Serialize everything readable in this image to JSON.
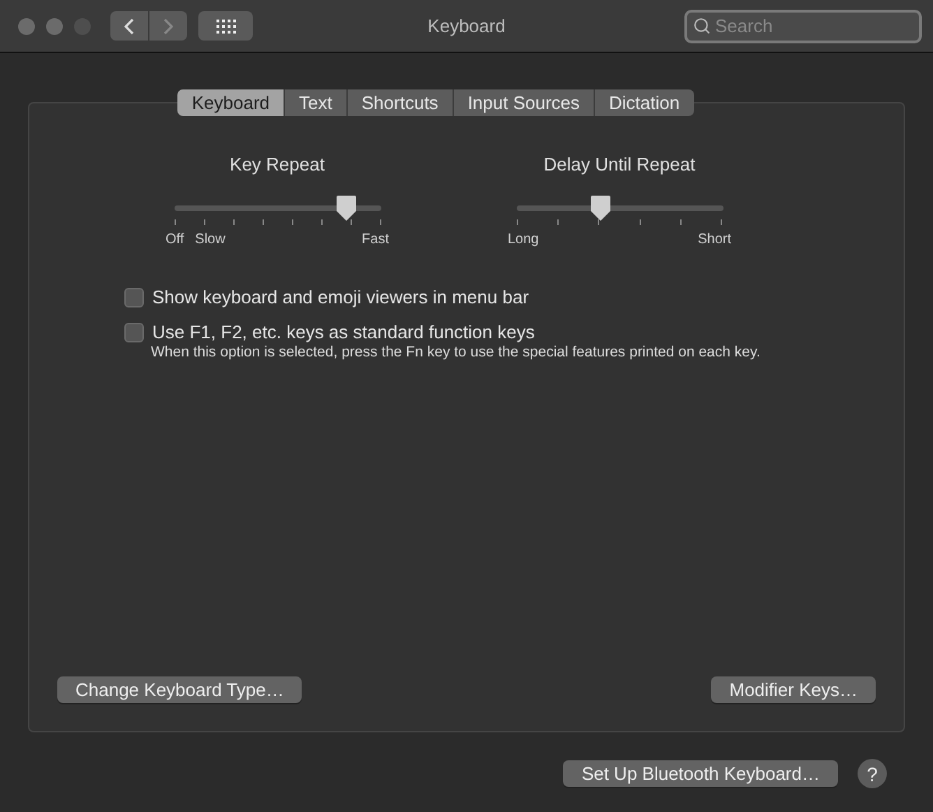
{
  "window": {
    "title": "Keyboard"
  },
  "toolbar": {
    "search": {
      "placeholder": "Search"
    }
  },
  "tabs": [
    {
      "label": "Keyboard",
      "selected": true
    },
    {
      "label": "Text",
      "selected": false
    },
    {
      "label": "Shortcuts",
      "selected": false
    },
    {
      "label": "Input Sources",
      "selected": false
    },
    {
      "label": "Dictation",
      "selected": false
    }
  ],
  "sliders": [
    {
      "title": "Key Repeat",
      "level": 0.857,
      "labels": [
        "Off",
        "Slow",
        "Fast"
      ]
    },
    {
      "title": "Delay Until Repeat",
      "level": 0.4,
      "labels": [
        "Long",
        "Short"
      ]
    }
  ],
  "options": [
    {
      "label": "Show keyboard and emoji viewers in menu bar",
      "checked": false
    },
    {
      "label": "Use F1, F2, etc. keys as standard function keys",
      "checked": false,
      "note": "When this option is selected, press the Fn key to use the special features printed on each key."
    }
  ],
  "panel_buttons": [
    "Change Keyboard Type…",
    "Modifier Keys…"
  ],
  "footer": {
    "button": "Set Up Bluetooth Keyboard…",
    "help": "?"
  }
}
